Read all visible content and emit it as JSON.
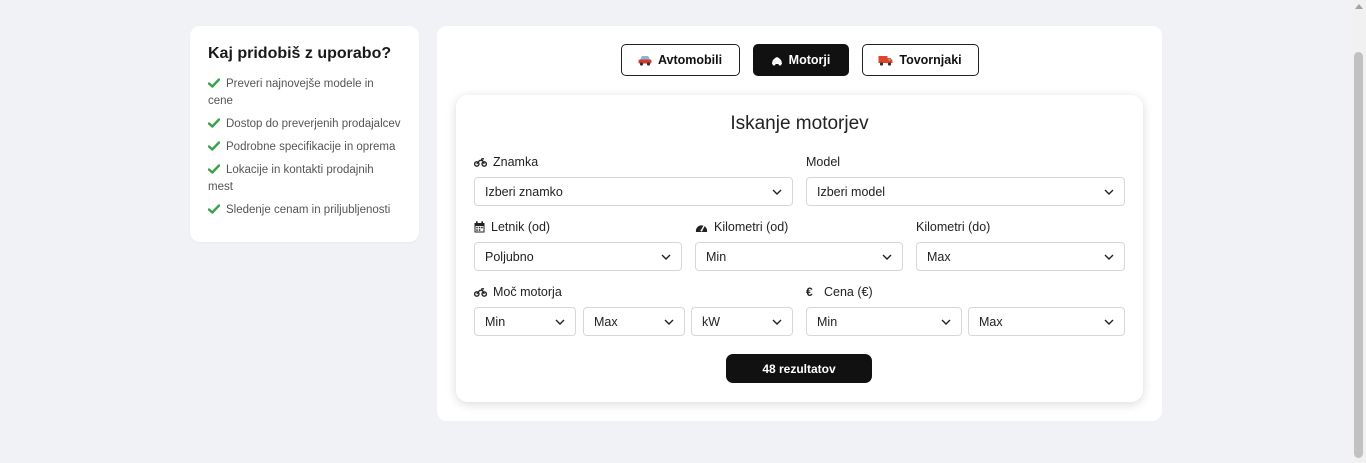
{
  "sidebar": {
    "title": "Kaj pridobiš z uporabo?",
    "benefits": [
      "Preveri najnovejše modele in cene",
      "Dostop do preverjenih prodajalcev",
      "Podrobne specifikacije in oprema",
      "Lokacije in kontakti prodajnih mest",
      "Sledenje cenam in priljubljenosti"
    ]
  },
  "tabs": [
    {
      "label": "Avtomobili",
      "icon": "car-icon",
      "active": false
    },
    {
      "label": "Motorji",
      "icon": "motorcycle-icon",
      "active": true
    },
    {
      "label": "Tovornjaki",
      "icon": "truck-icon",
      "active": false
    }
  ],
  "search": {
    "title": "Iskanje motorjev",
    "brand": {
      "label": "Znamka",
      "icon": "motorcycle-icon",
      "value": "Izberi znamko"
    },
    "model": {
      "label": "Model",
      "value": "Izberi model"
    },
    "year_from": {
      "label": "Letnik (od)",
      "icon": "calendar-icon",
      "value": "Poljubno"
    },
    "km_from": {
      "label": "Kilometri (od)",
      "icon": "speedometer-icon",
      "value": "Min"
    },
    "km_to": {
      "label": "Kilometri (do)",
      "value": "Max"
    },
    "power": {
      "label": "Moč motorja",
      "icon": "motorcycle-icon",
      "min": "Min",
      "max": "Max",
      "unit": "kW"
    },
    "price": {
      "label": "Cena (€)",
      "icon": "euro-icon",
      "min": "Min",
      "max": "Max"
    },
    "results_button": "48 rezultatov"
  },
  "colors": {
    "background": "#f1f2f6",
    "accent_dark": "#111111",
    "check_green": "#3aa14a",
    "truck_orange": "#e0452b",
    "car_red": "#d8382e"
  }
}
